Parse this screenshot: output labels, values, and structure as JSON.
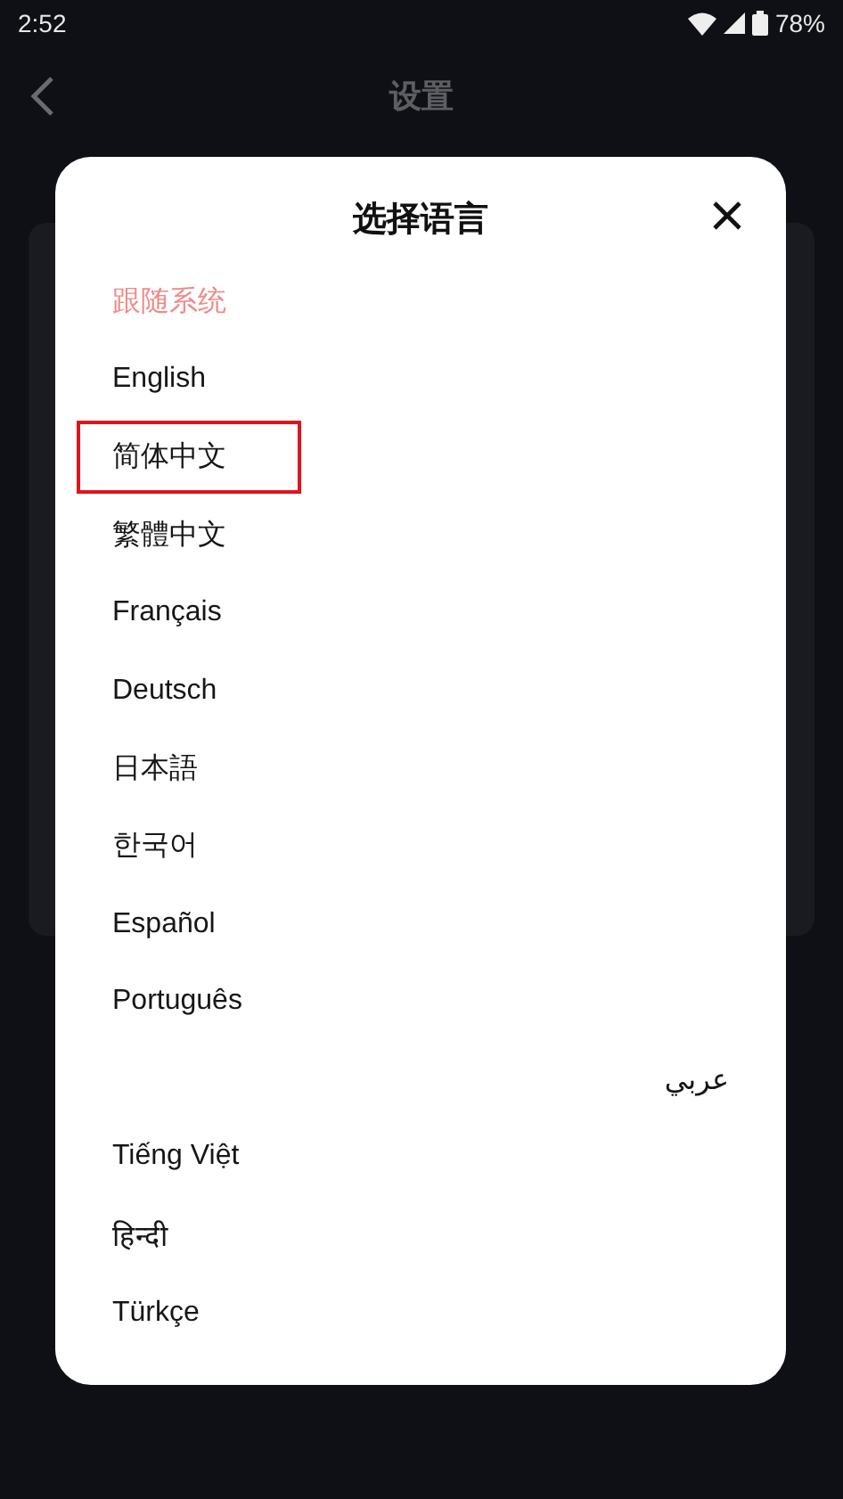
{
  "status_bar": {
    "time": "2:52",
    "battery": "78%"
  },
  "header": {
    "title": "设置"
  },
  "dialog": {
    "title": "选择语言",
    "languages": [
      {
        "label": "跟随系统",
        "selected": true,
        "boxed": false
      },
      {
        "label": "English",
        "selected": false,
        "boxed": false
      },
      {
        "label": "简体中文",
        "selected": false,
        "boxed": true
      },
      {
        "label": "繁體中文",
        "selected": false,
        "boxed": false
      },
      {
        "label": "Français",
        "selected": false,
        "boxed": false
      },
      {
        "label": "Deutsch",
        "selected": false,
        "boxed": false
      },
      {
        "label": "日本語",
        "selected": false,
        "boxed": false
      },
      {
        "label": "한국어",
        "selected": false,
        "boxed": false
      },
      {
        "label": "Español",
        "selected": false,
        "boxed": false
      },
      {
        "label": "Português",
        "selected": false,
        "boxed": false
      },
      {
        "label": "عربي",
        "selected": false,
        "boxed": false
      },
      {
        "label": "Tiếng Việt",
        "selected": false,
        "boxed": false
      },
      {
        "label": "हिन्दी",
        "selected": false,
        "boxed": false
      },
      {
        "label": "Türkçe",
        "selected": false,
        "boxed": false
      }
    ]
  }
}
